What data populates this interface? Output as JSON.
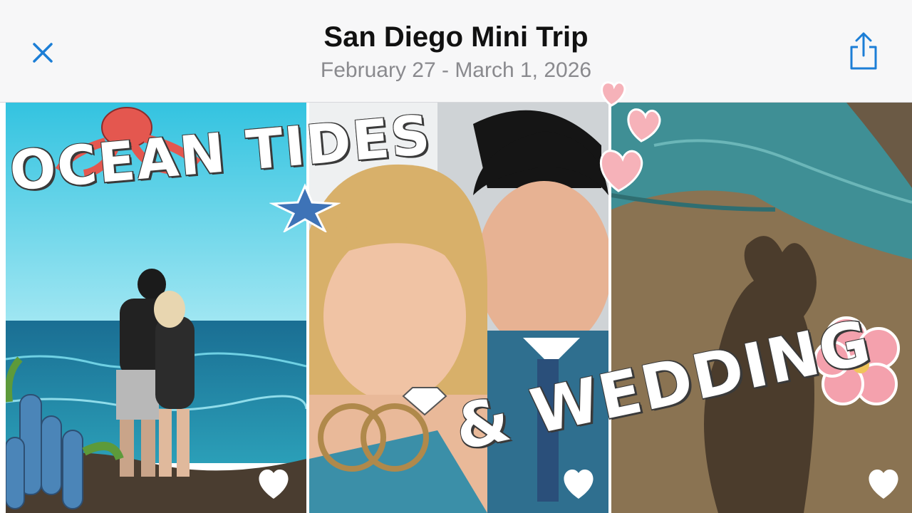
{
  "header": {
    "title": "San Diego Mini Trip",
    "date_range": "February 27 - March 1, 2026",
    "close_icon": "close-icon",
    "share_icon": "share-icon"
  },
  "overlay": {
    "line1": "OCEAN TIDES",
    "line2": "& WEDDING"
  },
  "photos": [
    {
      "name": "couple-by-ocean",
      "favorite": false
    },
    {
      "name": "couple-selfie",
      "favorite": false
    },
    {
      "name": "heart-shadow-tidepool",
      "favorite": false
    }
  ],
  "colors": {
    "accent": "#1c7ed6",
    "header_bg": "#f7f7f8"
  }
}
